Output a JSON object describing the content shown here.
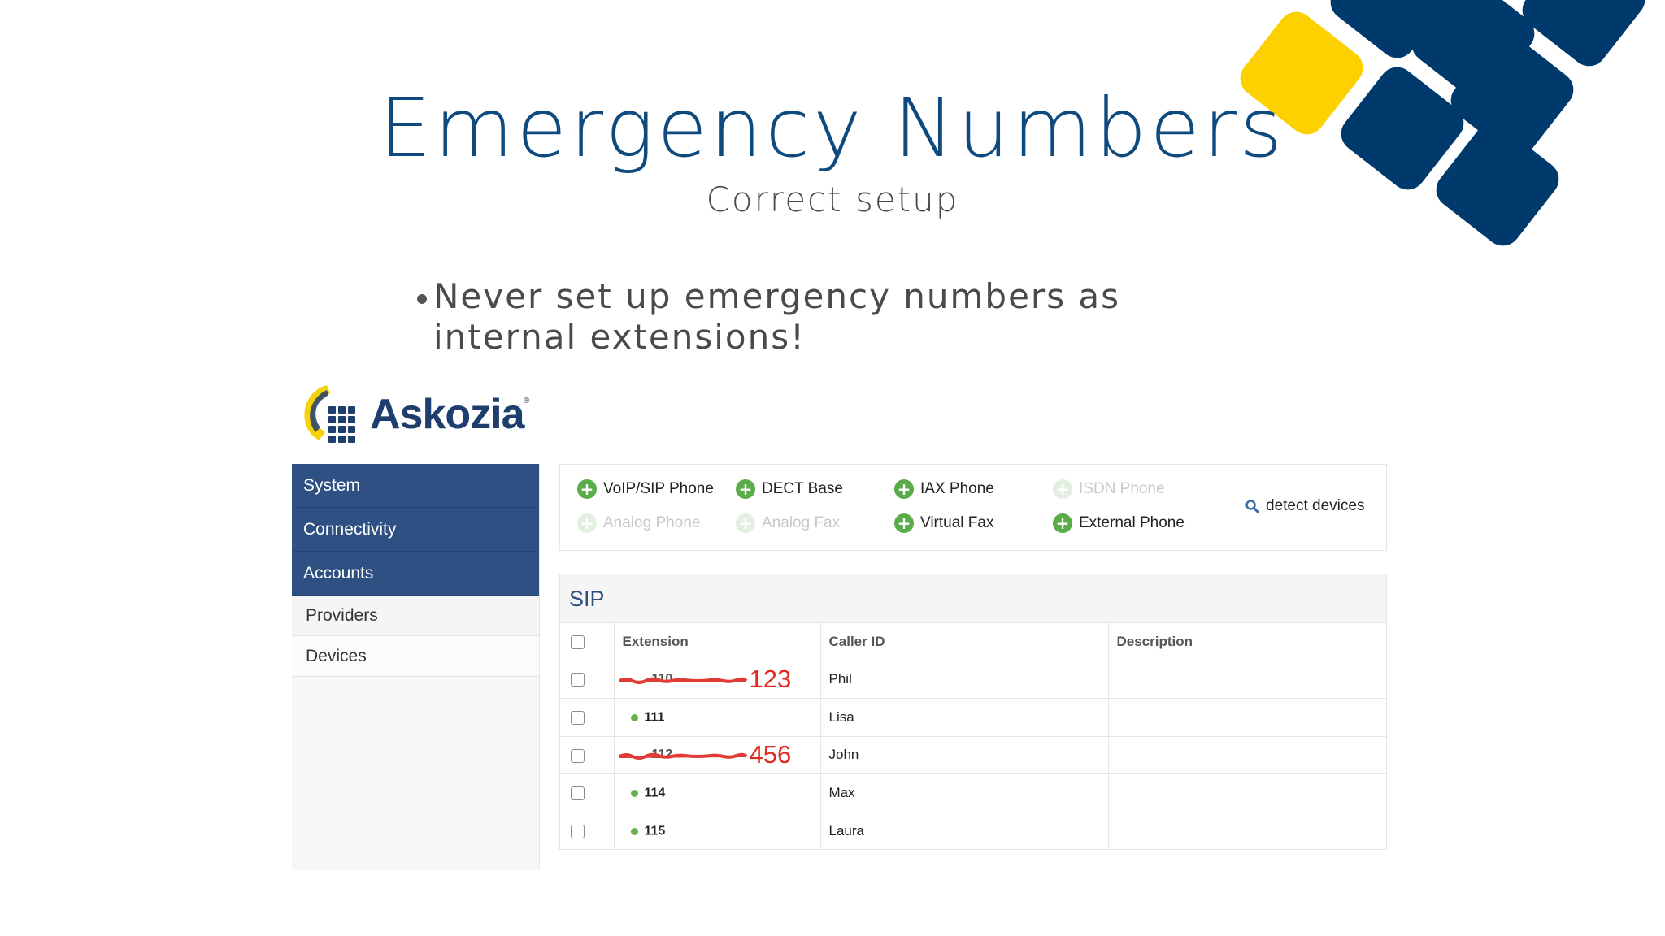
{
  "slide": {
    "title": "Emergency Numbers",
    "subtitle": "Correct setup",
    "bullet": "Never set up emergency numbers as internal extensions!"
  },
  "colors": {
    "title": "#0e4a7e",
    "tile_navy": "#003a6c",
    "tile_yellow": "#fdd000",
    "sidebar_active": "#2f5082",
    "add_icon": "#5aab4a",
    "correction": "#e02a1f"
  },
  "logo": {
    "name": "Askozia",
    "registered": "®"
  },
  "sidebar": {
    "main_items": [
      "System",
      "Connectivity",
      "Accounts"
    ],
    "sub_items": [
      "Providers",
      "Devices"
    ]
  },
  "add_devices": {
    "items": [
      {
        "label": "VoIP/SIP Phone",
        "enabled": true,
        "icon": "plus-circle-icon"
      },
      {
        "label": "DECT Base",
        "enabled": true,
        "icon": "plus-circle-icon"
      },
      {
        "label": "IAX Phone",
        "enabled": true,
        "icon": "plus-circle-icon"
      },
      {
        "label": "ISDN Phone",
        "enabled": false,
        "icon": "plus-circle-icon"
      },
      {
        "label": "Analog Phone",
        "enabled": false,
        "icon": "plus-circle-icon"
      },
      {
        "label": "Analog Fax",
        "enabled": false,
        "icon": "plus-circle-icon"
      },
      {
        "label": "Virtual Fax",
        "enabled": true,
        "icon": "plus-circle-icon"
      },
      {
        "label": "External Phone",
        "enabled": true,
        "icon": "plus-circle-icon"
      }
    ],
    "detect_label": "detect devices",
    "detect_icon": "magnifier-icon"
  },
  "sip": {
    "title": "SIP",
    "columns": [
      "Extension",
      "Caller ID",
      "Description"
    ],
    "rows": [
      {
        "extension": "110",
        "corrected": "123",
        "struck": true,
        "caller_id": "Phil",
        "description": ""
      },
      {
        "extension": "111",
        "corrected": "",
        "struck": false,
        "caller_id": "Lisa",
        "description": ""
      },
      {
        "extension": "112",
        "corrected": "456",
        "struck": true,
        "caller_id": "John",
        "description": ""
      },
      {
        "extension": "114",
        "corrected": "",
        "struck": false,
        "caller_id": "Max",
        "description": ""
      },
      {
        "extension": "115",
        "corrected": "",
        "struck": false,
        "caller_id": "Laura",
        "description": ""
      }
    ]
  }
}
